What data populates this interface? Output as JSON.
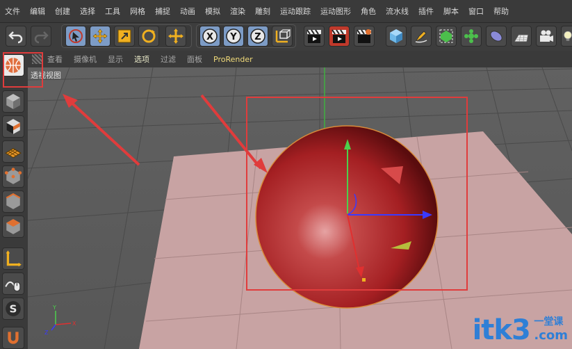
{
  "menu": [
    "文件",
    "编辑",
    "创建",
    "选择",
    "工具",
    "网格",
    "捕捉",
    "动画",
    "模拟",
    "渲染",
    "雕刻",
    "运动跟踪",
    "运动图形",
    "角色",
    "流水线",
    "插件",
    "脚本",
    "窗口",
    "帮助"
  ],
  "viewport_menu": [
    "查看",
    "摄像机",
    "显示",
    "选项",
    "过滤",
    "面板",
    "ProRender"
  ],
  "viewport_label": "透视视图",
  "axis_labels": {
    "y": "Y",
    "x": "X",
    "z": "Z"
  },
  "toolbar_icons": [
    "undo-icon",
    "redo-icon",
    "live-select-icon",
    "move-icon",
    "scale-icon",
    "rotate-icon",
    "recent-tool-icon",
    "x-axis-lock-icon",
    "y-axis-lock-icon",
    "z-axis-lock-icon",
    "coordinate-system-icon",
    "render-view-icon",
    "render-picture-viewer-icon",
    "render-settings-icon",
    "cube-icon",
    "pen-icon",
    "subdivision-icon",
    "cloner-icon",
    "deformer-icon",
    "floor-icon",
    "camera-icon",
    "light-icon"
  ],
  "sidebar_icons": [
    "model-mode-icon",
    "texture-mode-icon",
    "workplane-icon",
    "points-mode-icon",
    "edges-mode-icon",
    "polygons-mode-icon",
    "axis-mode-icon",
    "tweak-icon",
    "snap-icon",
    "magnet-icon"
  ],
  "watermark": {
    "brand": "itk3",
    "domain": ".com",
    "cn": "一堂课"
  },
  "colors": {
    "sphere": "#b3282a",
    "floor": "#c8a3a3",
    "highlight": "#e03c3c",
    "accent": "#f2dc7a"
  }
}
